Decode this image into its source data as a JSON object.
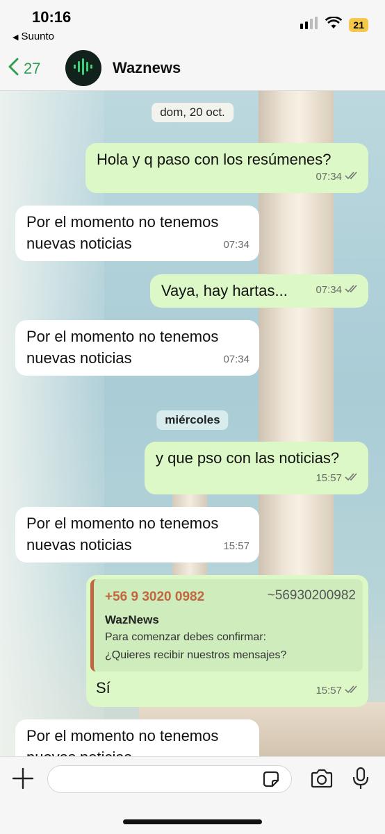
{
  "status_bar": {
    "time": "10:16",
    "back_app": "Suunto",
    "battery": "21"
  },
  "header": {
    "back_count": "27",
    "chat_name": "Waznews"
  },
  "chat": {
    "date_chip_1": "dom, 20 oct.",
    "date_chip_2": "miércoles",
    "messages": [
      {
        "dir": "out",
        "text": "Hola y q paso con los resúmenes?",
        "time": "07:34"
      },
      {
        "dir": "in",
        "text": "Por el momento no tenemos\nnuevas noticias",
        "time": "07:34"
      },
      {
        "dir": "out",
        "text": "Vaya, hay hartas...",
        "time": "07:34"
      },
      {
        "dir": "in",
        "text": "Por el momento no tenemos\nnuevas noticias",
        "time": "07:34"
      },
      {
        "dir": "out",
        "text": "y que pso con las noticias?",
        "time": "15:57"
      },
      {
        "dir": "in",
        "text": "Por el momento no tenemos\nnuevas noticias",
        "time": "15:57"
      },
      {
        "dir": "out",
        "text": "Sí",
        "time": "15:57",
        "quote": {
          "phone": "+56 9 3020 0982",
          "alias": "~56930200982",
          "name": "WazNews",
          "body": "Para comenzar debes confirmar:\n¿Quieres recibir nuestros mensajes?"
        }
      },
      {
        "dir": "in",
        "text": "Por el momento no tenemos\nnuevas noticias",
        "time": ""
      }
    ]
  },
  "input_bar": {
    "placeholder": ""
  },
  "colors": {
    "outgoing_bubble": "#dcf8c6",
    "incoming_bubble": "#ffffff",
    "accent_green": "#2f9e52",
    "quote_accent": "#c1663f"
  },
  "icons": [
    "signal-icon",
    "wifi-icon",
    "battery-icon",
    "back-chevron-icon",
    "waveform-logo-icon",
    "double-check-icon",
    "plus-icon",
    "sticker-icon",
    "camera-icon",
    "microphone-icon"
  ]
}
